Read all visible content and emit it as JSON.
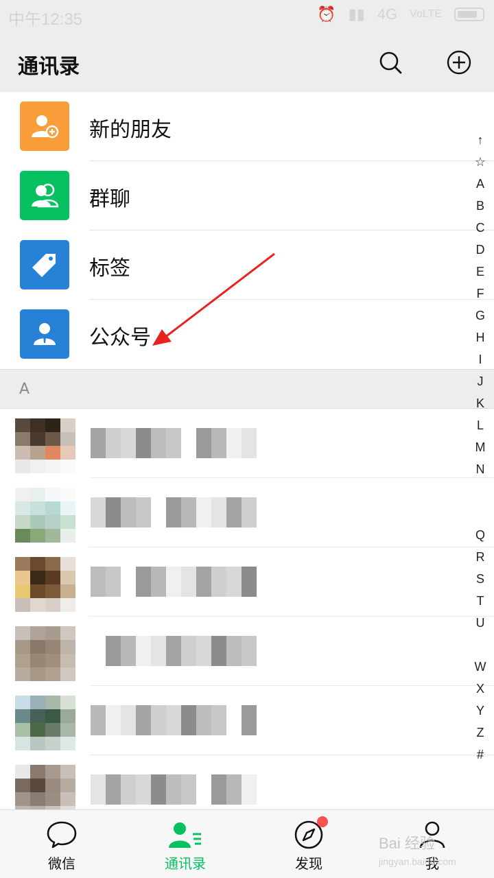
{
  "status_bar": {
    "time": "中午12:35",
    "network": "4G",
    "volte": "VoLTE"
  },
  "header": {
    "title": "通讯录",
    "search_icon": "search-icon",
    "add_icon": "plus-circle-icon"
  },
  "fixed_items": [
    {
      "label": "新的朋友",
      "icon": "add-friend-icon",
      "color": "#fa9d3b"
    },
    {
      "label": "群聊",
      "icon": "group-chat-icon",
      "color": "#07c160"
    },
    {
      "label": "标签",
      "icon": "tag-icon",
      "color": "#2782d7"
    },
    {
      "label": "公众号",
      "icon": "official-account-icon",
      "color": "#2782d7"
    }
  ],
  "section": {
    "letter": "A"
  },
  "contacts_note": "pixelated",
  "alphabet_index": [
    "↑",
    "☆",
    "A",
    "B",
    "C",
    "D",
    "E",
    "F",
    "G",
    "H",
    "I",
    "J",
    "K",
    "L",
    "M",
    "N",
    "",
    "",
    "Q",
    "R",
    "S",
    "T",
    "U",
    "",
    "W",
    "X",
    "Y",
    "Z",
    "#"
  ],
  "tabs": [
    {
      "label": "微信",
      "icon": "chat-bubble-icon",
      "active": false
    },
    {
      "label": "通讯录",
      "icon": "contacts-icon",
      "active": true
    },
    {
      "label": "发现",
      "icon": "compass-icon",
      "active": false,
      "badge": true
    },
    {
      "label": "我",
      "icon": "person-icon",
      "active": false
    }
  ],
  "colors": {
    "accent": "#07c160",
    "badge": "#fa5151",
    "arrow": "#e8231e"
  },
  "watermark": {
    "brand": "Bai 经验",
    "url": "jingyan.baidu.com"
  }
}
